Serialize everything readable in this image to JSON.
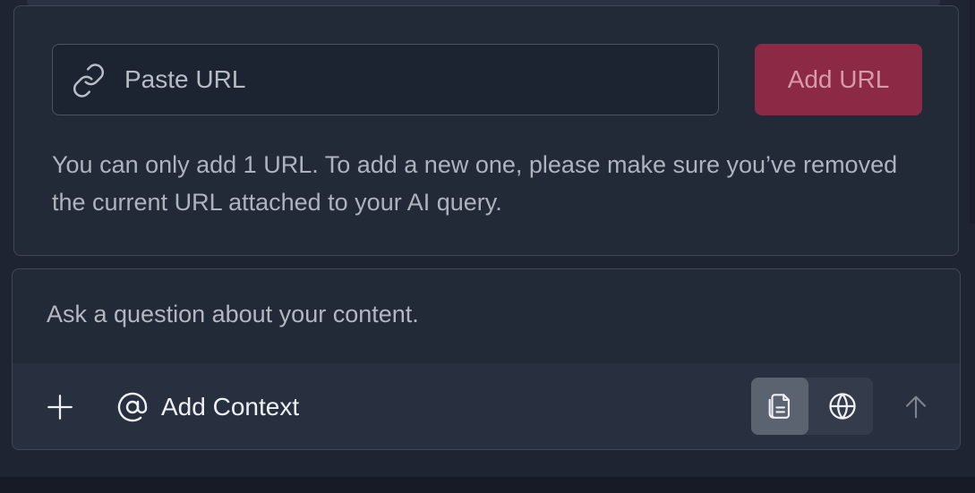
{
  "url_panel": {
    "input_placeholder": "Paste URL",
    "add_button_label": "Add URL",
    "note": "You can only add 1 URL. To add a new one, please make sure you’ve removed the current URL attached to your AI query.",
    "icon": "link-icon"
  },
  "chat": {
    "placeholder": "Ask a question about your content.",
    "toolbar": {
      "plus_icon": "plus-icon",
      "context_icon": "at-sign-icon",
      "context_label": "Add Context",
      "source_toggle": {
        "selected": "documents",
        "options": [
          {
            "name": "documents",
            "icon": "document-icon"
          },
          {
            "name": "web",
            "icon": "globe-icon"
          }
        ]
      },
      "send_icon": "arrow-up-icon"
    }
  },
  "colors": {
    "background": "#1e2432",
    "panel": "#222a38",
    "accent_button": "#8c2a45",
    "accent_text": "#d89aa9",
    "toolbar": "#283040"
  }
}
